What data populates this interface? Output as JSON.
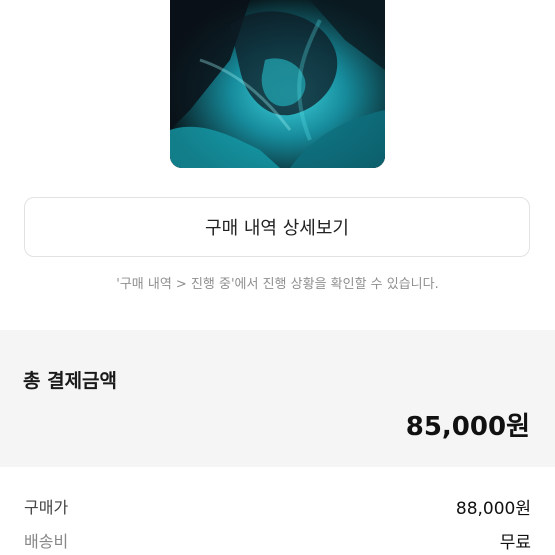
{
  "detail_button": {
    "label": "구매 내역 상세보기"
  },
  "notice": {
    "text": "'구매 내역 > 진행 중'에서 진행 상황을 확인할 수 있습니다."
  },
  "total": {
    "label": "총 결제금액",
    "amount": "85,000원"
  },
  "rows": [
    {
      "label": "구매가",
      "value": "88,000원"
    },
    {
      "label": "배송비",
      "value": "무료"
    }
  ],
  "colors": {
    "section_bg": "#f5f5f5",
    "image_tone": "#1fb7c7"
  }
}
